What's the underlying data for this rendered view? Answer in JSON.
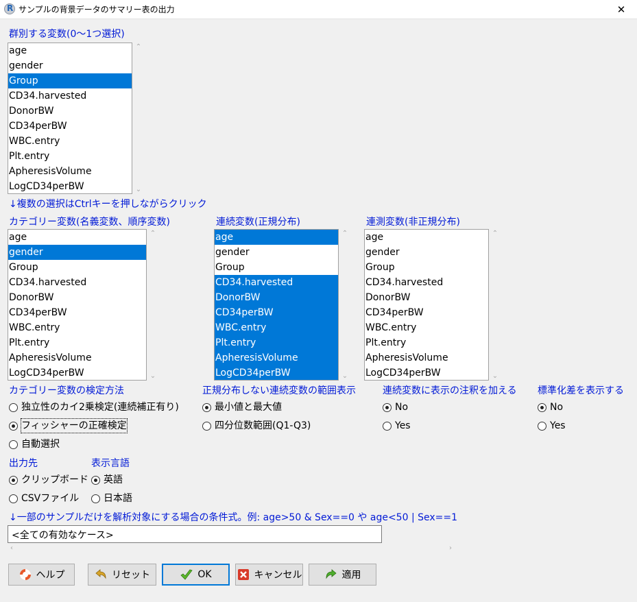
{
  "window": {
    "title": "サンプルの背景データのサマリー表の出力",
    "close": "✕"
  },
  "group_var": {
    "label": "群別する変数(0～1つ選択)",
    "items": [
      "age",
      "gender",
      "Group",
      "CD34.harvested",
      "DonorBW",
      "CD34perBW",
      "WBC.entry",
      "Plt.entry",
      "ApheresisVolume",
      "LogCD34perBW"
    ],
    "selected": [
      2
    ]
  },
  "hint_multi": "↓複数の選択はCtrlキーを押しながらクリック",
  "categorical": {
    "label": "カテゴリー変数(名義変数、順序変数)",
    "items": [
      "age",
      "gender",
      "Group",
      "CD34.harvested",
      "DonorBW",
      "CD34perBW",
      "WBC.entry",
      "Plt.entry",
      "ApheresisVolume",
      "LogCD34perBW"
    ],
    "selected": [
      1
    ]
  },
  "continuous_normal": {
    "label": "連続変数(正規分布)",
    "items": [
      "age",
      "gender",
      "Group",
      "CD34.harvested",
      "DonorBW",
      "CD34perBW",
      "WBC.entry",
      "Plt.entry",
      "ApheresisVolume",
      "LogCD34perBW"
    ],
    "selected": [
      0,
      3,
      4,
      5,
      6,
      7,
      8,
      9
    ]
  },
  "continuous_nonnormal": {
    "label": "連測変数(非正規分布)",
    "items": [
      "age",
      "gender",
      "Group",
      "CD34.harvested",
      "DonorBW",
      "CD34perBW",
      "WBC.entry",
      "Plt.entry",
      "ApheresisVolume",
      "LogCD34perBW"
    ],
    "selected": []
  },
  "test_method": {
    "label": "カテゴリー変数の検定方法",
    "options": [
      "独立性のカイ2乗検定(連続補正有り)",
      "フィッシャーの正確検定",
      "自動選択"
    ],
    "selected": 1
  },
  "range_display": {
    "label": "正規分布しない連続変数の範囲表示",
    "options": [
      "最小値と最大値",
      "四分位数範囲(Q1-Q3)"
    ],
    "selected": 0
  },
  "annotation": {
    "label": "連続変数に表示の注釈を加える",
    "options": [
      "No",
      "Yes"
    ],
    "selected": 0
  },
  "std_diff": {
    "label": "標準化差を表示する",
    "options": [
      "No",
      "Yes"
    ],
    "selected": 0
  },
  "output_dest": {
    "label": "出力先",
    "options": [
      "クリップボード",
      "CSVファイル"
    ],
    "selected": 0
  },
  "display_lang": {
    "label": "表示言語",
    "options": [
      "英語",
      "日本語"
    ],
    "selected": 0
  },
  "subset": {
    "label": "↓一部のサンプルだけを解析対象にする場合の条件式。例: age>50 & Sex==0 や age<50 | Sex==1",
    "value": "<全ての有効なケース>"
  },
  "buttons": {
    "help": "ヘルプ",
    "reset": "リセット",
    "ok": "OK",
    "cancel": "キャンセル",
    "apply": "適用"
  },
  "colors": {
    "selection": "#0078d7",
    "label_blue": "#0019d6"
  }
}
